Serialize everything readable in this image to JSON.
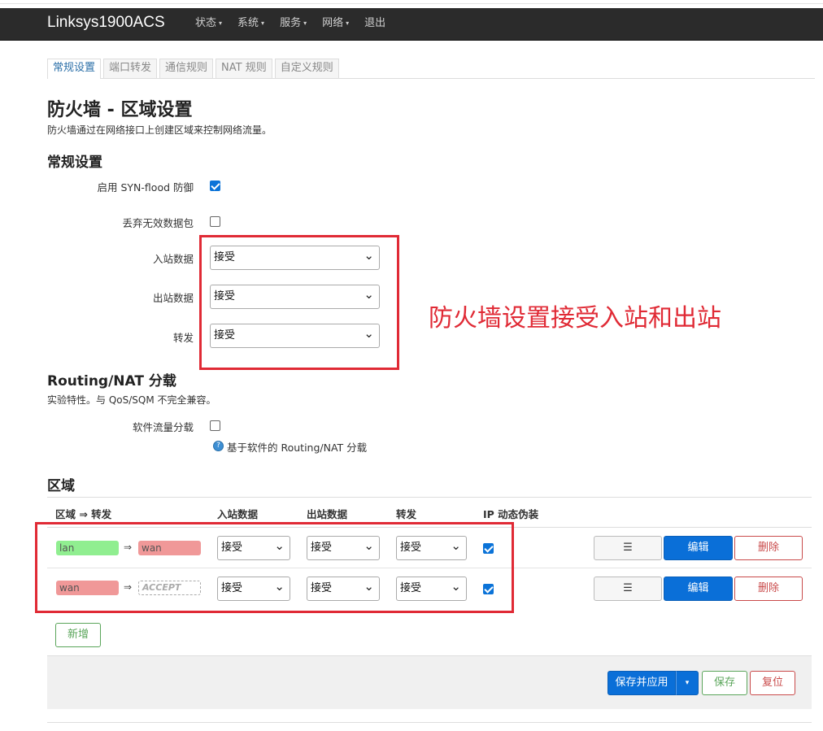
{
  "navbar": {
    "brand": "Linksys1900ACS",
    "menu": [
      {
        "label": "状态",
        "caret": "▾"
      },
      {
        "label": "系统",
        "caret": "▾"
      },
      {
        "label": "服务",
        "caret": "▾"
      },
      {
        "label": "网络",
        "caret": "▾"
      },
      {
        "label": "退出",
        "caret": ""
      }
    ]
  },
  "tabs": [
    {
      "label": "常规设置",
      "active": true
    },
    {
      "label": "端口转发",
      "active": false
    },
    {
      "label": "通信规则",
      "active": false
    },
    {
      "label": "NAT 规则",
      "active": false
    },
    {
      "label": "自定义规则",
      "active": false
    }
  ],
  "page": {
    "title": "防火墙 - 区域设置",
    "description": "防火墙通过在网络接口上创建区域来控制网络流量。"
  },
  "general": {
    "heading": "常规设置",
    "syn_flood_label": "启用 SYN-flood 防御",
    "syn_flood_checked": true,
    "drop_invalid_label": "丢弃无效数据包",
    "drop_invalid_checked": false,
    "input_label": "入站数据",
    "input_value": "接受",
    "output_label": "出站数据",
    "output_value": "接受",
    "forward_label": "转发",
    "forward_value": "接受"
  },
  "annotation": "防火墙设置接受入站和出站",
  "offload": {
    "heading": "Routing/NAT 分载",
    "description": "实验特性。与 QoS/SQM 不完全兼容。",
    "software_label": "软件流量分载",
    "software_checked": false,
    "help_icon": "?",
    "help_text": "基于软件的 Routing/NAT 分载"
  },
  "zones": {
    "heading": "区域",
    "headers": {
      "zone": "区域 ⇒ 转发",
      "input": "入站数据",
      "output": "出站数据",
      "forward": "转发",
      "masq": "IP 动态伪装"
    },
    "rows": [
      {
        "zone": "lan",
        "arrow": "⇒",
        "dest": "wan",
        "input": "接受",
        "output": "接受",
        "forward": "接受",
        "masq": true
      },
      {
        "zone": "wan",
        "arrow": "⇒",
        "dest": "ACCEPT",
        "input": "接受",
        "output": "接受",
        "forward": "接受",
        "masq": true
      }
    ],
    "buttons": {
      "reorder": "☰",
      "edit": "编辑",
      "delete": "删除"
    },
    "add_label": "新增"
  },
  "footer": {
    "save_apply": "保存并应用",
    "dropdown": "▾",
    "save": "保存",
    "reset": "复位"
  },
  "colors": {
    "navbar": "#2b2b2b",
    "primary": "#0a6fd8",
    "annotation_red": "#e02a35",
    "zone_lan": "#90ee90",
    "zone_wan": "#f09898"
  }
}
